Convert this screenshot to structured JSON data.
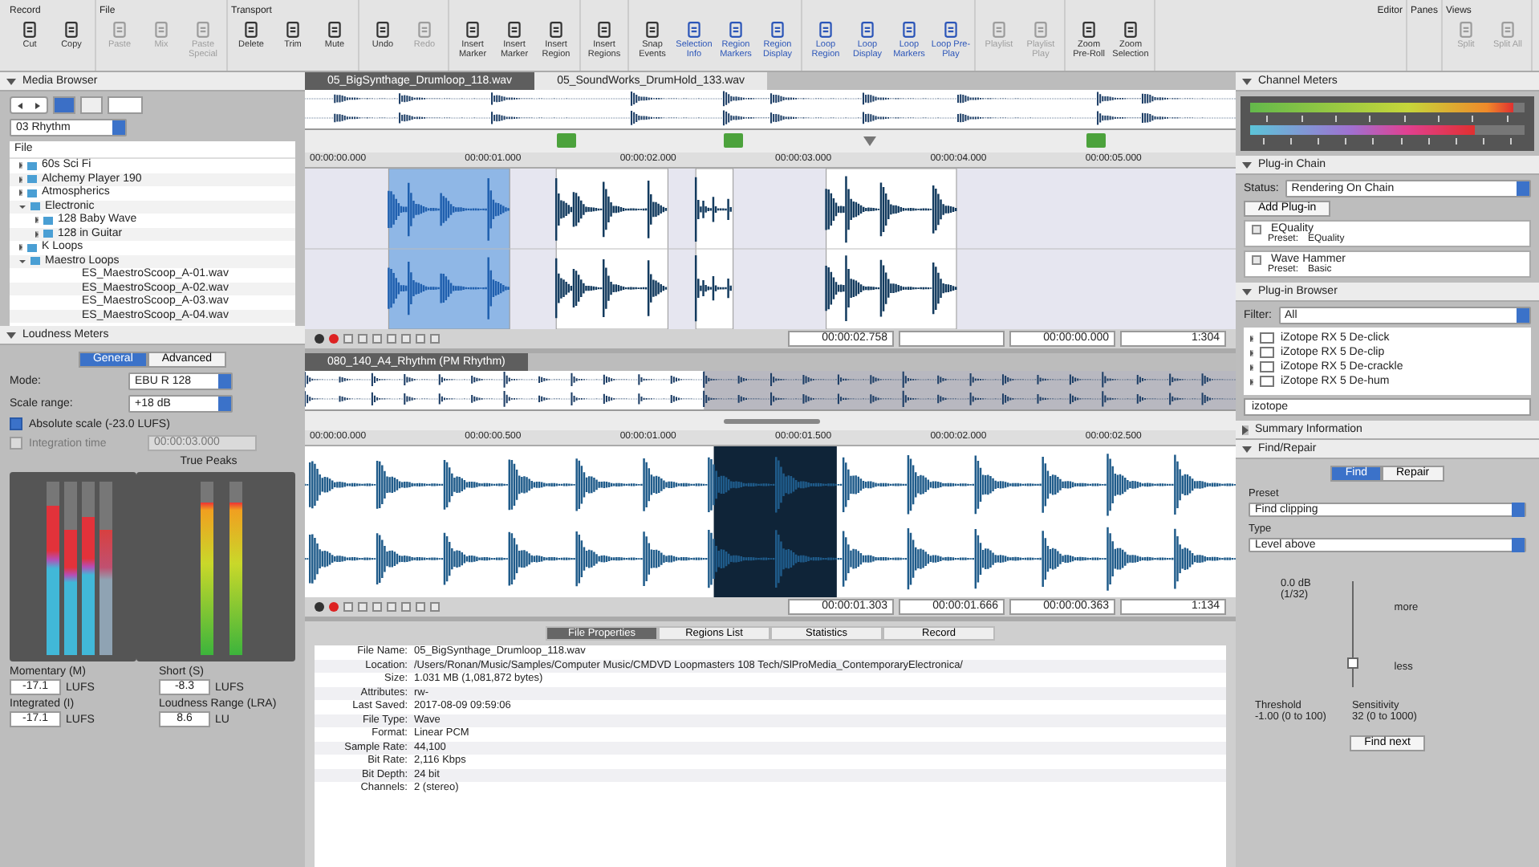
{
  "toolbar": {
    "groups": [
      {
        "label": "Record",
        "buttons": [
          {
            "label": "Cut",
            "on": false,
            "disabled": false
          },
          {
            "label": "Copy",
            "on": false,
            "disabled": false
          }
        ]
      },
      {
        "label": "File",
        "buttons": [
          {
            "label": "Paste",
            "on": false,
            "disabled": true
          },
          {
            "label": "Mix",
            "on": false,
            "disabled": true
          },
          {
            "label": "Paste Special",
            "on": false,
            "disabled": true
          }
        ]
      },
      {
        "label": "Transport",
        "buttons": [
          {
            "label": "Delete",
            "on": false,
            "disabled": false
          },
          {
            "label": "Trim",
            "on": false,
            "disabled": false
          },
          {
            "label": "Mute",
            "on": false,
            "disabled": false
          }
        ]
      },
      {
        "buttons": [
          {
            "label": "Undo",
            "on": false,
            "disabled": false
          },
          {
            "label": "Redo",
            "on": false,
            "disabled": true
          }
        ]
      },
      {
        "buttons": [
          {
            "label": "Insert Marker",
            "on": false,
            "disabled": false
          },
          {
            "label": "Insert Marker",
            "on": false,
            "disabled": false
          },
          {
            "label": "Insert Region",
            "on": false,
            "disabled": false
          }
        ]
      },
      {
        "buttons": [
          {
            "label": "Insert Regions",
            "on": false,
            "disabled": false
          }
        ]
      },
      {
        "buttons": [
          {
            "label": "Snap Events",
            "on": false,
            "disabled": false
          },
          {
            "label": "Selection Info",
            "on": true,
            "disabled": false
          },
          {
            "label": "Region Markers",
            "on": true,
            "disabled": false
          },
          {
            "label": "Region Display",
            "on": true,
            "disabled": false
          }
        ]
      },
      {
        "buttons": [
          {
            "label": "Loop Region",
            "on": true,
            "disabled": false
          },
          {
            "label": "Loop Display",
            "on": true,
            "disabled": false
          },
          {
            "label": "Loop Markers",
            "on": true,
            "disabled": false
          },
          {
            "label": "Loop Pre-Play",
            "on": true,
            "disabled": false
          }
        ]
      },
      {
        "buttons": [
          {
            "label": "Playlist",
            "on": false,
            "disabled": true
          },
          {
            "label": "Playlist Play",
            "on": false,
            "disabled": true
          }
        ]
      },
      {
        "buttons": [
          {
            "label": "Zoom Pre-Roll",
            "on": false,
            "disabled": false
          },
          {
            "label": "Zoom Selection",
            "on": false,
            "disabled": false
          }
        ]
      }
    ],
    "right_groups": [
      {
        "label": "Editor"
      },
      {
        "label": "Panes"
      },
      {
        "label": "Views",
        "buttons": [
          {
            "label": "Split",
            "on": false,
            "disabled": true
          },
          {
            "label": "Split All",
            "on": false,
            "disabled": true
          }
        ]
      }
    ]
  },
  "media_browser": {
    "title": "Media Browser",
    "location": "03 Rhythm",
    "column": "File",
    "tree": [
      {
        "label": "60s Sci Fi",
        "kind": "folder",
        "expanded": false
      },
      {
        "label": "Alchemy Player 190",
        "kind": "folder",
        "expanded": false
      },
      {
        "label": "Atmospherics",
        "kind": "folder",
        "expanded": false
      },
      {
        "label": "Electronic",
        "kind": "folder",
        "expanded": true,
        "children": [
          {
            "label": "128 Baby Wave",
            "kind": "folder",
            "expanded": false
          },
          {
            "label": "128 in Guitar",
            "kind": "folder",
            "expanded": false
          }
        ]
      },
      {
        "label": "K Loops",
        "kind": "folder",
        "expanded": false
      },
      {
        "label": "Maestro Loops",
        "kind": "folder",
        "expanded": true,
        "children": [
          {
            "label": "ES_MaestroScoop_A-01.wav",
            "kind": "file"
          },
          {
            "label": "ES_MaestroScoop_A-02.wav",
            "kind": "file"
          },
          {
            "label": "ES_MaestroScoop_A-03.wav",
            "kind": "file"
          },
          {
            "label": "ES_MaestroScoop_A-04.wav",
            "kind": "file"
          }
        ]
      }
    ]
  },
  "loudness": {
    "title": "Loudness Meters",
    "tabs": [
      {
        "label": "General",
        "selected": true
      },
      {
        "label": "Advanced",
        "selected": false
      }
    ],
    "mode": {
      "label": "Mode:",
      "value": "EBU R 128"
    },
    "scale": {
      "label": "Scale range:",
      "value": "+18 dB"
    },
    "absolute": {
      "label": "Absolute scale (-23.0 LUFS)",
      "checked": true
    },
    "integration": {
      "label": "Integration time",
      "value": "00:00:03.000",
      "disabled": true
    },
    "true_peaks_label": "True Peaks",
    "meters": [
      {
        "level": 0.86
      },
      {
        "level": 0.72
      },
      {
        "level": 0.8
      },
      {
        "level": 0.72
      }
    ],
    "peaks": [
      {
        "level": 0.88
      },
      {
        "level": 0.88
      }
    ],
    "readings": [
      {
        "label": "Momentary (M)",
        "value": "-17.1",
        "unit": "LUFS"
      },
      {
        "label": "Short (S)",
        "value": "-8.3",
        "unit": "LUFS"
      },
      {
        "label": "Integrated (I)",
        "value": "-17.1",
        "unit": "LUFS"
      },
      {
        "label": "Loudness Range (LRA)",
        "value": "8.6",
        "unit": "LU"
      }
    ]
  },
  "editor_top": {
    "tabs": [
      {
        "label": "05_BigSynthage_Drumloop_118.wav",
        "selected": true
      },
      {
        "label": "05_SoundWorks_DrumHold_133.wav",
        "selected": false
      }
    ],
    "ruler": [
      "00:00:00.000",
      "00:00:01.000",
      "00:00:02.000",
      "00:00:03.000",
      "00:00:04.000",
      "00:00:05.000"
    ],
    "fields": [
      "00:00:02.758",
      "00:00:00.000",
      "1:304"
    ]
  },
  "editor_bottom": {
    "tabs": [
      {
        "label": "080_140_A4_Rhythm (PM Rhythm)",
        "selected": true
      }
    ],
    "ruler": [
      "00:00:00.000",
      "00:00:00.500",
      "00:00:01.000",
      "00:00:01.500",
      "00:00:02.000",
      "00:00:02.500"
    ],
    "fields": [
      "00:00:01.303",
      "00:00:01.666",
      "00:00:00.363",
      "1:134"
    ]
  },
  "properties": {
    "tabs": [
      {
        "label": "File Properties",
        "selected": true
      },
      {
        "label": "Regions List",
        "selected": false
      },
      {
        "label": "Statistics",
        "selected": false
      },
      {
        "label": "Record",
        "selected": false
      }
    ],
    "rows": [
      {
        "label": "File Name:",
        "value": "05_BigSynthage_Drumloop_118.wav"
      },
      {
        "label": "Location:",
        "value": "/Users/Ronan/Music/Samples/Computer Music/CMDVD Loopmasters 108 Tech/SlProMedia_ContemporaryElectronica/"
      },
      {
        "label": "Size:",
        "value": "1.031 MB (1,081,872 bytes)"
      },
      {
        "label": "Attributes:",
        "value": "rw-"
      },
      {
        "label": "Last Saved:",
        "value": "2017-08-09 09:59:06"
      },
      {
        "label": "File Type:",
        "value": "Wave"
      },
      {
        "label": "Format:",
        "value": "Linear PCM"
      },
      {
        "label": "Sample Rate:",
        "value": "44,100"
      },
      {
        "label": "Bit Rate:",
        "value": "2,116 Kbps"
      },
      {
        "label": "Bit Depth:",
        "value": "24 bit"
      },
      {
        "label": "Channels:",
        "value": "2 (stereo)"
      }
    ]
  },
  "channel_meters": {
    "title": "Channel Meters",
    "peak_meter": {
      "level": 0.96
    },
    "loudness_meter": {
      "level": 0.82
    }
  },
  "plugin_chain": {
    "title": "Plug-in Chain",
    "status_label": "Status:",
    "status": "Rendering On Chain",
    "add": "Add Plug-in",
    "plugins": [
      {
        "name": "EQuality",
        "preset_label": "Preset:",
        "preset": "EQuality"
      },
      {
        "name": "Wave Hammer",
        "preset_label": "Preset:",
        "preset": "Basic"
      }
    ]
  },
  "plugin_browser": {
    "title": "Plug-in Browser",
    "filter_label": "Filter:",
    "filter": "All",
    "items": [
      "iZotope RX 5 De-click",
      "iZotope RX 5 De-clip",
      "iZotope RX 5 De-crackle",
      "iZotope RX 5 De-hum"
    ],
    "search": "izotope"
  },
  "summary": {
    "title": "Summary Information",
    "expanded": false
  },
  "find_repair": {
    "title": "Find/Repair",
    "expanded": true,
    "tabs": [
      {
        "label": "Find",
        "selected": true
      },
      {
        "label": "Repair",
        "selected": false
      }
    ],
    "preset_label": "Preset",
    "preset": "Find clipping",
    "type_label": "Type",
    "type": "Level above",
    "graph_top": "0.0 dB",
    "graph_sub": "(1/32)",
    "more": "more",
    "less": "less",
    "threshold_label": "Threshold",
    "threshold": "-1.00 (0 to 100)",
    "sensitivity_label": "Sensitivity",
    "sensitivity": "32 (0 to 1000)",
    "button": "Find next"
  }
}
